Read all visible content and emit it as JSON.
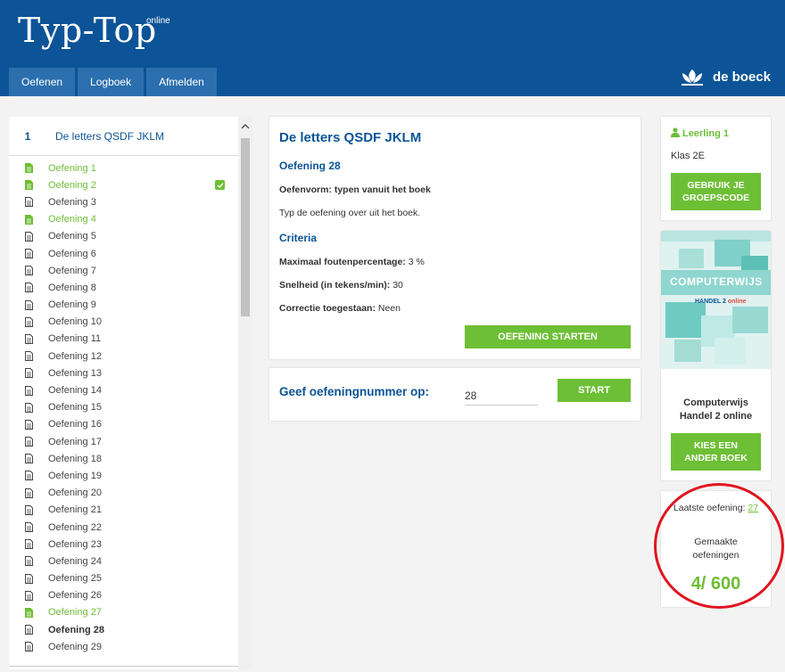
{
  "header": {
    "logo": "Typ-Top",
    "logo_sup": "online",
    "nav": [
      "Oefenen",
      "Logboek",
      "Afmelden"
    ],
    "brand": "de boeck"
  },
  "chapter": {
    "number": "1",
    "title": "De letters QSDF JKLM"
  },
  "exercises": [
    {
      "label": "Oefening 1",
      "status": "done"
    },
    {
      "label": "Oefening 2",
      "status": "done",
      "checked": true
    },
    {
      "label": "Oefening 3",
      "status": "todo"
    },
    {
      "label": "Oefening 4",
      "status": "done"
    },
    {
      "label": "Oefening 5",
      "status": "todo"
    },
    {
      "label": "Oefening 6",
      "status": "todo"
    },
    {
      "label": "Oefening 7",
      "status": "todo"
    },
    {
      "label": "Oefening 8",
      "status": "todo"
    },
    {
      "label": "Oefening 9",
      "status": "todo"
    },
    {
      "label": "Oefening 10",
      "status": "todo"
    },
    {
      "label": "Oefening 11",
      "status": "todo"
    },
    {
      "label": "Oefening 12",
      "status": "todo"
    },
    {
      "label": "Oefening 13",
      "status": "todo"
    },
    {
      "label": "Oefening 14",
      "status": "todo"
    },
    {
      "label": "Oefening 15",
      "status": "todo"
    },
    {
      "label": "Oefening 16",
      "status": "todo"
    },
    {
      "label": "Oefening 17",
      "status": "todo"
    },
    {
      "label": "Oefening 18",
      "status": "todo"
    },
    {
      "label": "Oefening 19",
      "status": "todo"
    },
    {
      "label": "Oefening 20",
      "status": "todo"
    },
    {
      "label": "Oefening 21",
      "status": "todo"
    },
    {
      "label": "Oefening 22",
      "status": "todo"
    },
    {
      "label": "Oefening 23",
      "status": "todo"
    },
    {
      "label": "Oefening 24",
      "status": "todo"
    },
    {
      "label": "Oefening 25",
      "status": "todo"
    },
    {
      "label": "Oefening 26",
      "status": "todo"
    },
    {
      "label": "Oefening 27",
      "status": "done"
    },
    {
      "label": "Oefening 28",
      "status": "active"
    },
    {
      "label": "Oefening 29",
      "status": "todo"
    }
  ],
  "main": {
    "title": "De letters QSDF JKLM",
    "exercise_heading": "Oefening 28",
    "form_label": "Oefenvorm: typen vanuit het boek",
    "instruction": "Typ de oefening over uit het boek.",
    "criteria_heading": "Criteria",
    "max_error_label": "Maximaal foutenpercentage:",
    "max_error_value": "3 %",
    "speed_label": "Snelheid (in tekens/min):",
    "speed_value": "30",
    "correction_label": "Correctie toegestaan:",
    "correction_value": "Neen",
    "start_button": "OEFENING STARTEN"
  },
  "number_entry": {
    "label": "Geef oefeningnummer op:",
    "value": "28",
    "start_button": "START"
  },
  "user": {
    "name": "Leerling 1",
    "class": "Klas 2E",
    "group_button_line1": "GEBRUIK JE",
    "group_button_line2": "GROEPSCODE"
  },
  "book": {
    "cover_title": "COMPUTERWIJS",
    "cover_sub_main": "HANDEL 2",
    "cover_sub_accent": "online",
    "name_line1": "Computerwijs",
    "name_line2": "Handel 2 online",
    "button_line1": "KIES EEN",
    "button_line2": "ANDER BOEK"
  },
  "stats": {
    "last_label": "Laatste oefening:",
    "last_value": "27",
    "made_line1": "Gemaakte",
    "made_line2": "oefeningen",
    "made_count": "4/ 600"
  },
  "colors": {
    "header_blue": "#0c5497",
    "accent_green": "#6dbf35",
    "annotation_red": "#e0141e"
  }
}
